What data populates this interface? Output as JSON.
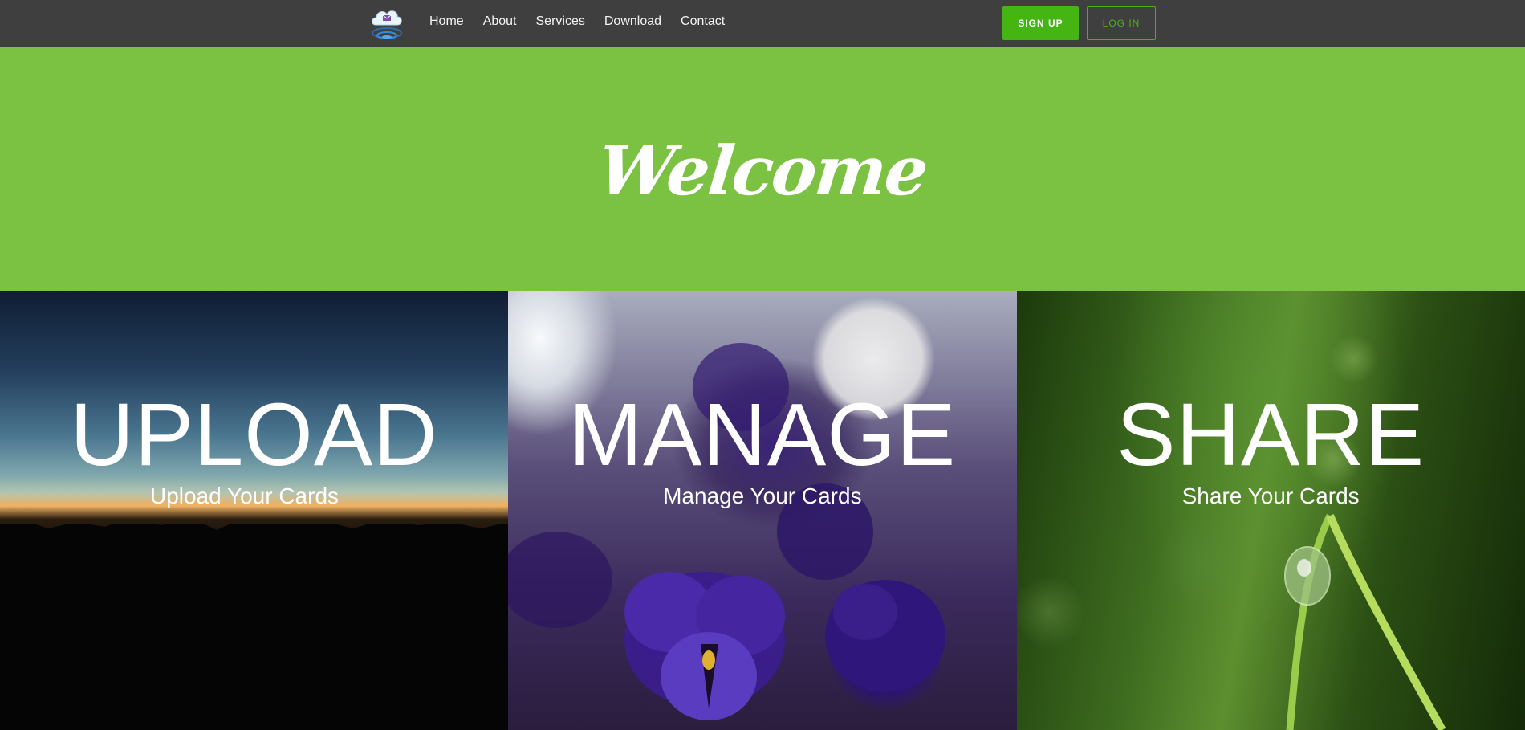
{
  "nav": {
    "logo_icon": "cloud-mail-icon",
    "links": [
      "Home",
      "About",
      "Services",
      "Download",
      "Contact"
    ],
    "signup_label": "SIGN UP",
    "login_label": "LOG IN"
  },
  "hero": {
    "title": "Welcome"
  },
  "panels": [
    {
      "heading": "UPLOAD",
      "subtitle": "Upload Your Cards"
    },
    {
      "heading": "MANAGE",
      "subtitle": "Manage Your Cards"
    },
    {
      "heading": "SHARE",
      "subtitle": "Share Your Cards"
    }
  ],
  "colors": {
    "navbar": "#3f3f3f",
    "accent_green": "#45b514",
    "hero_green": "#7bc142",
    "text_white": "#ffffff"
  }
}
